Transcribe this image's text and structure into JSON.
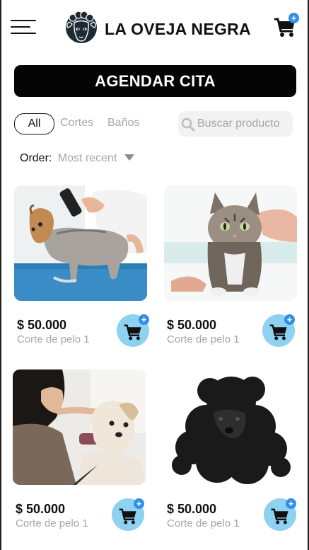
{
  "header": {
    "menu_icon": "hamburger-menu-icon",
    "logo_icon": "black-sheep-logo",
    "brand": "LA OVEJA NEGRA",
    "cart_icon": "shopping-cart-icon",
    "cart_badge": "+"
  },
  "cta": {
    "label": "AGENDAR CITA"
  },
  "filters": [
    {
      "label": "All",
      "selected": true
    },
    {
      "label": "Cortes",
      "selected": false
    },
    {
      "label": "Baños",
      "selected": false
    }
  ],
  "search": {
    "placeholder": "Buscar producto",
    "icon": "search-icon"
  },
  "order": {
    "label": "Order:",
    "value": "Most recent",
    "icon": "caret-down-icon"
  },
  "products": [
    {
      "price": "$ 50.000",
      "name": "Corte de pelo 1",
      "image": "yorkshire-being-groomed-photo",
      "add_badge": "+"
    },
    {
      "price": "$ 50.000",
      "name": "Corte de pelo 1",
      "image": "wet-tabby-cat-photo",
      "add_badge": "+"
    },
    {
      "price": "$ 50.000",
      "name": "Corte de pelo 1",
      "image": "woman-grooming-white-dog-photo",
      "add_badge": "+"
    },
    {
      "price": "$ 50.000",
      "name": "Corte de pelo 1",
      "image": "black-poodle-photo",
      "add_badge": "+"
    }
  ],
  "colors": {
    "accent_blue": "#2f8fe6",
    "cart_button_bg": "#8ed1f1",
    "cta_bg": "#050505",
    "muted_text": "#a6a6a6"
  }
}
